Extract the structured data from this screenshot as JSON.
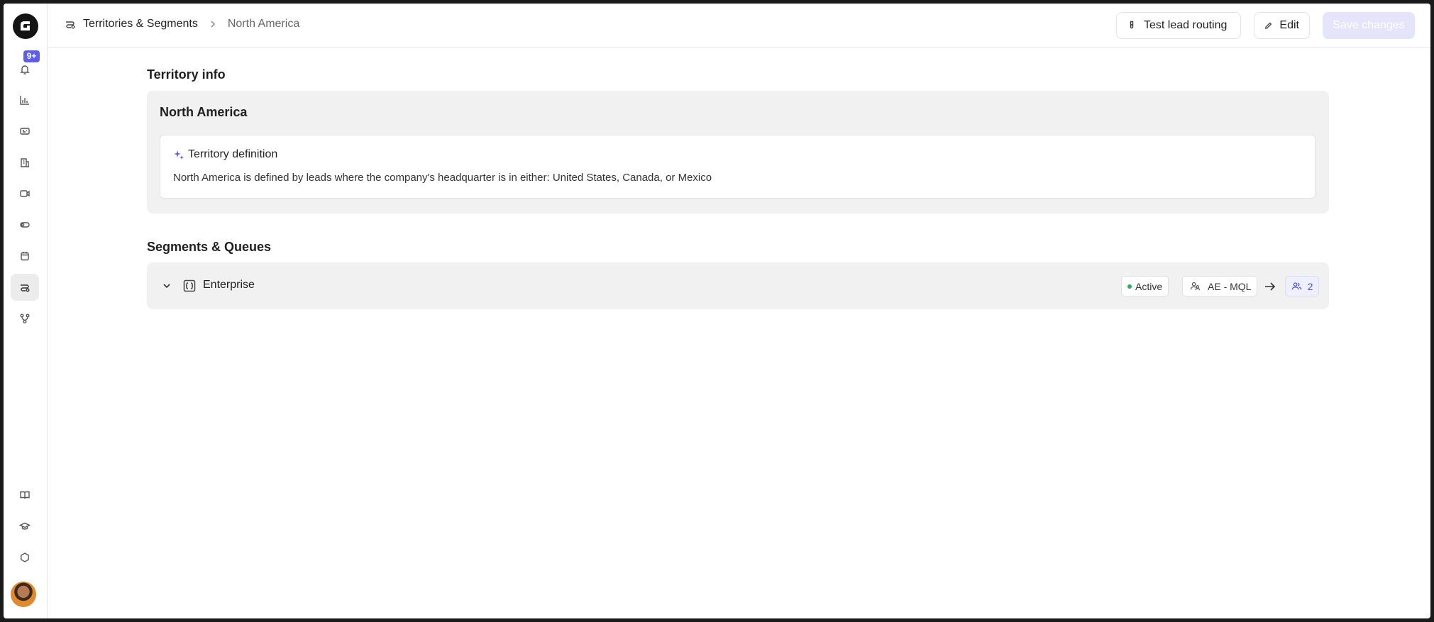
{
  "sidebar": {
    "notifications_badge": "9+",
    "items": [
      "bell-icon",
      "chart-icon",
      "card-icon",
      "building-icon",
      "truck-icon",
      "toggle-icon",
      "calendar-icon",
      "routing-icon",
      "flow-icon",
      "book-icon",
      "graduation-icon",
      "hexagon-icon"
    ]
  },
  "breadcrumb": {
    "parent": "Territories & Segments",
    "current": "North America"
  },
  "toolbar": {
    "test_label": "Test lead routing",
    "edit_label": "Edit",
    "save_label": "Save changes"
  },
  "territory_info": {
    "section_title": "Territory info",
    "name": "North America",
    "definition_title": "Territory definition",
    "definition_text": "North America is defined by leads where the company's headquarter is in either: United States, Canada, or Mexico"
  },
  "segments": {
    "section_title": "Segments & Queues",
    "rows": [
      {
        "name": "Enterprise",
        "status": "Active",
        "queue": "AE - MQL",
        "members": "2"
      }
    ]
  },
  "colors": {
    "accent": "#5b5ef0",
    "active_status": "#2fae5a"
  }
}
